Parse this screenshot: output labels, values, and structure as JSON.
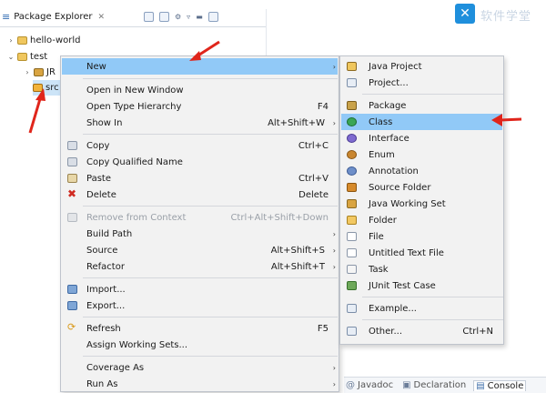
{
  "explorer": {
    "title": "Package Explorer",
    "close_glyph": "✕",
    "tree": [
      {
        "label": "hello-world"
      },
      {
        "label": "test"
      },
      {
        "label": "JR"
      },
      {
        "label": "src"
      }
    ]
  },
  "branding": {
    "logo_glyph": "✕",
    "text": "软件学堂"
  },
  "menu": {
    "items": [
      {
        "label": "New",
        "shortcut": "",
        "submenu": "›"
      },
      {
        "label": "Open in New Window",
        "shortcut": ""
      },
      {
        "label": "Open Type Hierarchy",
        "shortcut": "F4"
      },
      {
        "label": "Show In",
        "shortcut": "Alt+Shift+W",
        "submenu": "›"
      },
      {
        "label": "Copy",
        "shortcut": "Ctrl+C"
      },
      {
        "label": "Copy Qualified Name",
        "shortcut": ""
      },
      {
        "label": "Paste",
        "shortcut": "Ctrl+V"
      },
      {
        "label": "Delete",
        "shortcut": "Delete"
      },
      {
        "label": "Remove from Context",
        "shortcut": "Ctrl+Alt+Shift+Down"
      },
      {
        "label": "Build Path",
        "shortcut": "",
        "submenu": "›"
      },
      {
        "label": "Source",
        "shortcut": "Alt+Shift+S",
        "submenu": "›"
      },
      {
        "label": "Refactor",
        "shortcut": "Alt+Shift+T",
        "submenu": "›"
      },
      {
        "label": "Import...",
        "shortcut": ""
      },
      {
        "label": "Export...",
        "shortcut": ""
      },
      {
        "label": "Refresh",
        "shortcut": "F5"
      },
      {
        "label": "Assign Working Sets...",
        "shortcut": ""
      },
      {
        "label": "Coverage As",
        "shortcut": "",
        "submenu": "›"
      },
      {
        "label": "Run As",
        "shortcut": "",
        "submenu": "›"
      }
    ]
  },
  "submenu": {
    "items": [
      {
        "label": "Java Project"
      },
      {
        "label": "Project..."
      },
      {
        "label": "Package"
      },
      {
        "label": "Class"
      },
      {
        "label": "Interface"
      },
      {
        "label": "Enum"
      },
      {
        "label": "Annotation"
      },
      {
        "label": "Source Folder"
      },
      {
        "label": "Java Working Set"
      },
      {
        "label": "Folder"
      },
      {
        "label": "File"
      },
      {
        "label": "Untitled Text File"
      },
      {
        "label": "Task"
      },
      {
        "label": "JUnit Test Case"
      },
      {
        "label": "Example..."
      },
      {
        "label": "Other...",
        "shortcut": "Ctrl+N"
      }
    ]
  },
  "bottom_tabs": [
    {
      "label": "Javadoc"
    },
    {
      "label": "Declaration"
    },
    {
      "label": "Console"
    }
  ],
  "colors": {
    "highlight": "#91c9f7",
    "menu_bg": "#f2f2f2",
    "annotation_arrow": "#e0251b"
  }
}
